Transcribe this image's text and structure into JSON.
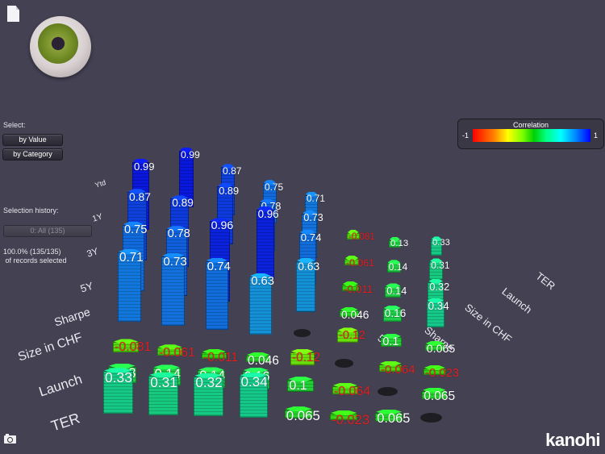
{
  "app": {
    "brand": "kanohi"
  },
  "toolbar": {
    "document_icon": "document-icon",
    "eye_control": "eye-camera-control",
    "camera_icon": "camera-icon"
  },
  "panel": {
    "select_label": "Select:",
    "by_value_label": "by Value",
    "by_category_label": "by Category",
    "history_label": "Selection history:",
    "history_item": "0: All (135)",
    "records_pct": "100.0% (135/135)",
    "records_text": " of records selected"
  },
  "legend": {
    "title": "Correlation",
    "min_label": "-1",
    "max_label": "1",
    "colors": [
      "#ff0000",
      "#ffff00",
      "#00d000",
      "#00ffff",
      "#0000ff"
    ]
  },
  "chart_data": {
    "type": "heatmap",
    "title": "Correlation",
    "variables": [
      "Ytd",
      "1Y",
      "3Y",
      "5Y",
      "Sharpe",
      "Size in CHF",
      "Launch",
      "TER"
    ],
    "row_axis_labels": [
      "Ytd",
      "1Y",
      "3Y",
      "5Y",
      "Sharpe",
      "Size in CHF",
      "Launch",
      "TER"
    ],
    "col_axis_labels": [
      "5Y",
      "Sharpe",
      "Size in CHF",
      "Launch",
      "TER"
    ],
    "value_range": [
      -1,
      1
    ],
    "cells": [
      {
        "row": "Ytd",
        "col": "1Y",
        "value": 0.99
      },
      {
        "row": "Ytd",
        "col": "3Y",
        "value": 0.87
      },
      {
        "row": "Ytd",
        "col": "5Y",
        "value": 0.75
      },
      {
        "row": "Ytd",
        "col": "Sharpe",
        "value": 0.71
      },
      {
        "row": "Ytd",
        "col": "Size in CHF",
        "value": -0.081
      },
      {
        "row": "Ytd",
        "col": "Launch",
        "value": 0.13
      },
      {
        "row": "Ytd",
        "col": "TER",
        "value": 0.33
      },
      {
        "row": "1Y",
        "col": "3Y",
        "value": 0.89
      },
      {
        "row": "1Y",
        "col": "5Y",
        "value": 0.78
      },
      {
        "row": "1Y",
        "col": "Sharpe",
        "value": 0.73
      },
      {
        "row": "1Y",
        "col": "Size in CHF",
        "value": -0.061
      },
      {
        "row": "1Y",
        "col": "Launch",
        "value": 0.14
      },
      {
        "row": "1Y",
        "col": "TER",
        "value": 0.31
      },
      {
        "row": "3Y",
        "col": "5Y",
        "value": 0.96
      },
      {
        "row": "3Y",
        "col": "Sharpe",
        "value": 0.74
      },
      {
        "row": "3Y",
        "col": "Size in CHF",
        "value": -0.011
      },
      {
        "row": "3Y",
        "col": "Launch",
        "value": 0.14
      },
      {
        "row": "3Y",
        "col": "TER",
        "value": 0.32
      },
      {
        "row": "5Y",
        "col": "Sharpe",
        "value": 0.63
      },
      {
        "row": "5Y",
        "col": "Size in CHF",
        "value": 0.046
      },
      {
        "row": "5Y",
        "col": "Launch",
        "value": 0.16
      },
      {
        "row": "5Y",
        "col": "TER",
        "value": 0.34
      },
      {
        "row": "Sharpe",
        "col": "Size in CHF",
        "value": -0.12
      },
      {
        "row": "Sharpe",
        "col": "Launch",
        "value": 0.1
      },
      {
        "row": "Sharpe",
        "col": "TER",
        "value": 0.065
      },
      {
        "row": "Size in CHF",
        "col": "Launch",
        "value": -0.064
      },
      {
        "row": "Size in CHF",
        "col": "TER",
        "value": -0.023
      },
      {
        "row": "Launch",
        "col": "TER",
        "value": 0.065
      }
    ]
  }
}
